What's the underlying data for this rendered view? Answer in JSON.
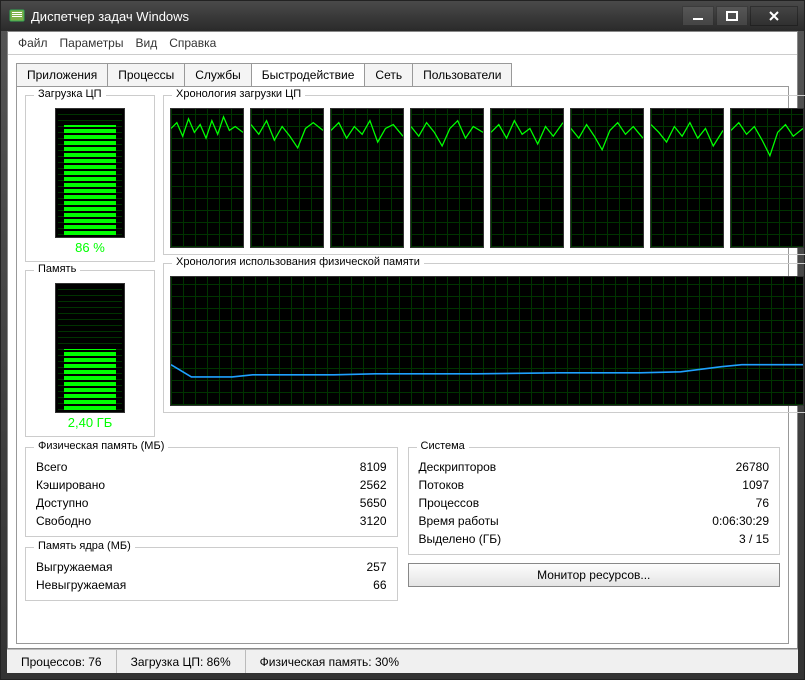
{
  "window": {
    "title": "Диспетчер задач Windows"
  },
  "menu": {
    "file": "Файл",
    "options": "Параметры",
    "view": "Вид",
    "help": "Справка"
  },
  "tabs": {
    "apps": "Приложения",
    "processes": "Процессы",
    "services": "Службы",
    "performance": "Быстродействие",
    "network": "Сеть",
    "users": "Пользователи"
  },
  "perf": {
    "cpu_group": "Загрузка ЦП",
    "cpu_pct": "86 %",
    "cpu_history_group": "Хронология загрузки ЦП",
    "mem_group": "Память",
    "mem_val": "2,40 ГБ",
    "mem_history_group": "Хронология использования физической памяти"
  },
  "phys": {
    "title": "Физическая память (МБ)",
    "total_l": "Всего",
    "total_v": "8109",
    "cached_l": "Кэшировано",
    "cached_v": "2562",
    "avail_l": "Доступно",
    "avail_v": "5650",
    "free_l": "Свободно",
    "free_v": "3120"
  },
  "kernel": {
    "title": "Память ядра (МБ)",
    "paged_l": "Выгружаемая",
    "paged_v": "257",
    "nonpaged_l": "Невыгружаемая",
    "nonpaged_v": "66"
  },
  "system": {
    "title": "Система",
    "handles_l": "Дескрипторов",
    "handles_v": "26780",
    "threads_l": "Потоков",
    "threads_v": "1097",
    "procs_l": "Процессов",
    "procs_v": "76",
    "uptime_l": "Время работы",
    "uptime_v": "0:06:30:29",
    "commit_l": "Выделено (ГБ)",
    "commit_v": "3 / 15"
  },
  "res_btn": "Монитор ресурсов...",
  "status": {
    "procs": "Процессов: 76",
    "cpu": "Загрузка ЦП: 86%",
    "mem": "Физическая память: 30%"
  },
  "chart_data": {
    "cpu_meter_pct": 86,
    "mem_meter_pct": 30,
    "cpu_cores": 8,
    "cpu_history_note": "green traces per core, approx 70–100% with dips",
    "mem_history_note": "blue trace, approx flat around 28–32%"
  }
}
